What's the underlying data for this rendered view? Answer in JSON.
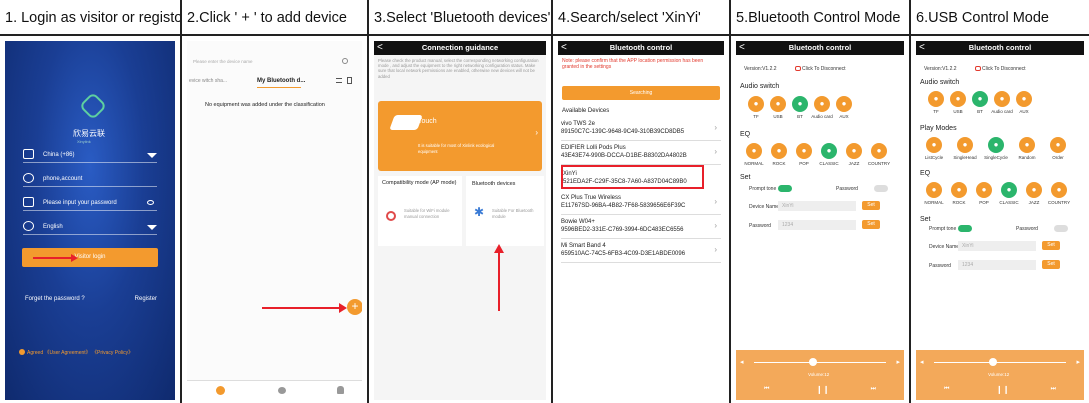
{
  "captions": [
    "1. Login as visitor or registor",
    "2.Click ' + ' to add device",
    "3.Select  'Bluetooth devices'",
    "4.Search/select 'XinYi'",
    "5.Bluetooth Control Mode",
    "6.USB Control Mode"
  ],
  "p1": {
    "brand": "欣易云联",
    "brand_sub": "Xinyiink",
    "country": "China  (+86)",
    "account": "phone,account",
    "password": "Please input your password",
    "language": "English",
    "visitor_btn": "Visitor login",
    "forgot": "Forget the password ?",
    "register": "Register",
    "agree": "Agreed  《User Agreement》 《Privacy Policy》"
  },
  "p2": {
    "search": "Please enter the device name",
    "tab1": "evice witch sha...",
    "tab2": "My Bluetooth d...",
    "empty": "No equipment was added under the classification",
    "add": "+"
  },
  "p3": {
    "title": "Connection guidance",
    "notice": "Please check the product manual, select the corresponding networking configuration mode , and adjust the equipment to the right networking configuration status. Make sure that local network permissions are enabled, otherwise new devices will not be added",
    "touch_title": "Touch",
    "touch_desc": "It is suitable for most of Xinlink ecological equipment",
    "compat_title": "Compatibility mode (AP mode)",
    "compat_desc": "Suitable for WiFi module manual connection",
    "bt_title": "Bluetooth devices",
    "bt_desc": "Suitable For Bluetooth module"
  },
  "p4": {
    "title": "Bluetooth control",
    "note": "Note: please confirm that the APP location permission has been granted in the settings",
    "searching": "Searching",
    "avail": "Available Devices",
    "devices": [
      {
        "name": "vivo TWS 2e",
        "id": "89150C7C-139C-9648-9C49-310B39CD8DB5"
      },
      {
        "name": "EDIFIER Lolli Pods Plus",
        "id": "43E43E74-990B-DCCA-D1BE-B8302DA4802B"
      },
      {
        "name": "XinYi",
        "id": "521EDA2F-C29F-35C8-7A60-A837D04C89B0"
      },
      {
        "name": "CX Plus True Wireless",
        "id": "E11767SD-96BA-4B82-7F68-5839656E6F39C"
      },
      {
        "name": "Bowie W04+",
        "id": "9596BED2-331E-C769-3994-6DC483EC6556"
      },
      {
        "name": "Mi Smart Band 4",
        "id": "659510AC-74C5-6FB3-4C09-D3E1ABDE0096"
      }
    ]
  },
  "p5": {
    "title": "Bluetooth control",
    "version": "Version:V1.2.2",
    "disconnect": "Click To Disconnect",
    "audio": "Audio switch",
    "audio_items": [
      "TF",
      "USB",
      "BT",
      "Audio card",
      "AUX"
    ],
    "eq": "EQ",
    "eq_items": [
      "NORMAL",
      "ROCK",
      "POP",
      "CLASSIC",
      "JAZZ",
      "COUNTRY"
    ],
    "set": "Set",
    "prompt": "Prompt tone",
    "password_lbl": "Password",
    "device_name": "Device Name",
    "device_val": "XinYi",
    "pwd": "Password",
    "pwd_val": "1234",
    "set_btn": "Set",
    "volume": "Volume:12",
    "volume_level": 0.45
  },
  "p6": {
    "title": "Bluetooth control",
    "version": "Version:V1.2.2",
    "disconnect": "Click To Disconnect",
    "audio": "Audio switch",
    "audio_items": [
      "TF",
      "USB",
      "BT",
      "Audio card",
      "AUX"
    ],
    "play": "Play Modes",
    "play_items": [
      "ListCycle",
      "SingleHead",
      "SingleCycle",
      "Random",
      "Order"
    ],
    "eq": "EQ",
    "eq_items": [
      "NORMAL",
      "ROCK",
      "POP",
      "CLASSIC",
      "JAZZ",
      "COUNTRY"
    ],
    "set": "Set",
    "prompt": "Prompt tone",
    "password_lbl": "Password",
    "device_name": "Device Name",
    "device_val": "XinYi",
    "pwd": "Password",
    "pwd_val": "1234",
    "set_btn": "Set",
    "volume": "Volume:12",
    "volume_level": 0.45
  }
}
